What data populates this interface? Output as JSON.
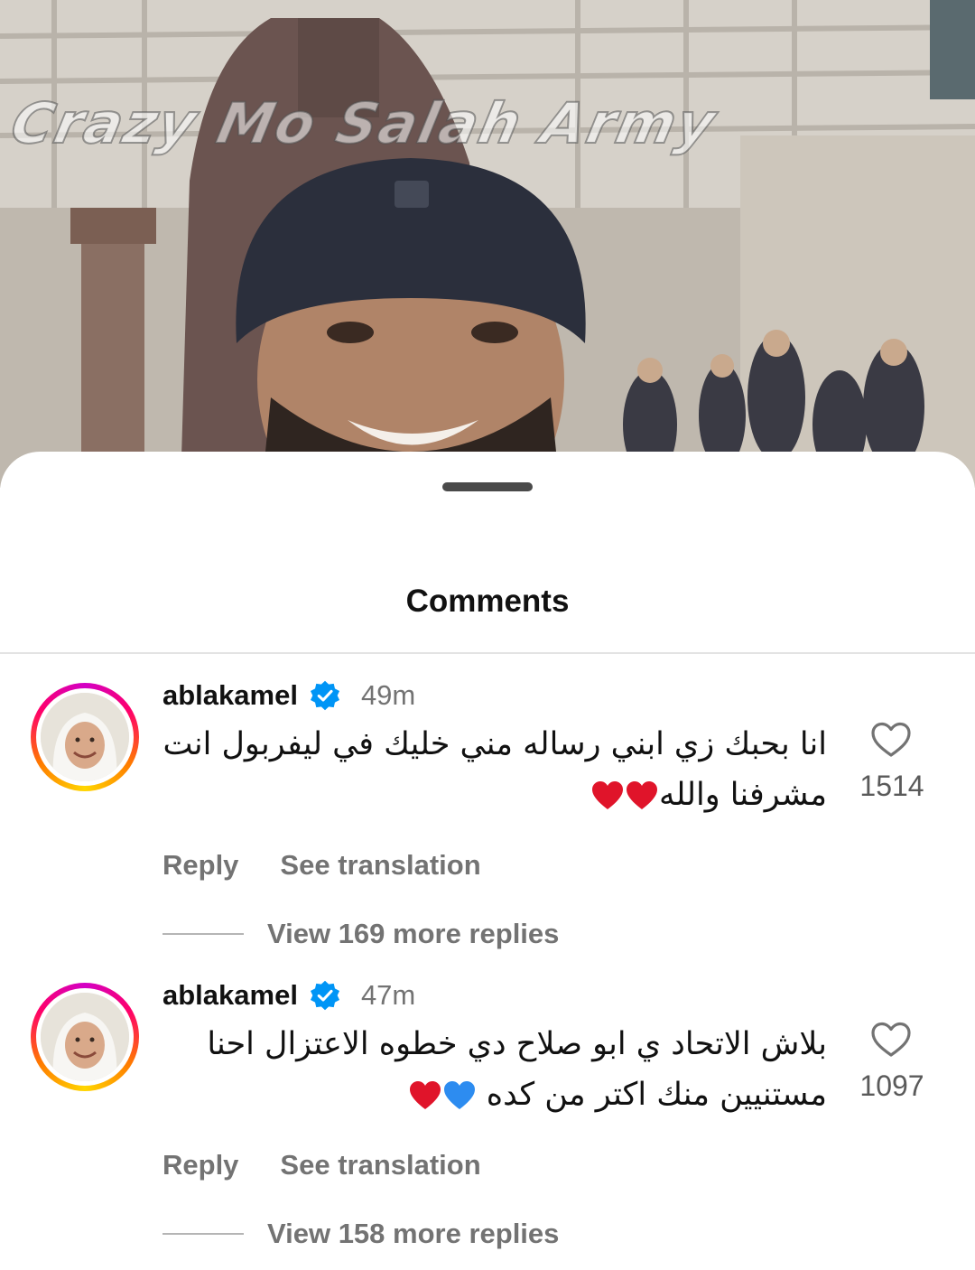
{
  "photo": {
    "watermark": "Crazy Mo Salah Army"
  },
  "sheet": {
    "title": "Comments"
  },
  "comments": [
    {
      "username": "ablakamel",
      "timestamp": "49m",
      "text_line1": "انا بحبك زي ابني رساله مني خليك في ليفربول انت",
      "text_line2": "مشرفنا والله",
      "emojis": [
        "red-heart-icon",
        "red-heart-icon"
      ],
      "like_count": "1514",
      "reply_label": "Reply",
      "translation_label": "See translation",
      "view_replies_label": "View 169 more replies"
    },
    {
      "username": "ablakamel",
      "timestamp": "47m",
      "text_line1": "بلاش الاتحاد ي ابو صلاح دي خطوه الاعتزال احنا",
      "text_line2": "مستنيين منك اكتر من كده",
      "emojis": [
        "blue-heart-icon",
        "red-heart-icon"
      ],
      "like_count": "1097",
      "reply_label": "Reply",
      "translation_label": "See translation",
      "view_replies_label": "View 158 more replies"
    }
  ],
  "colors": {
    "verified": "#0095f6",
    "red_heart": "#e0142a",
    "blue_heart": "#2d8cf0",
    "muted_text": "#737373"
  }
}
